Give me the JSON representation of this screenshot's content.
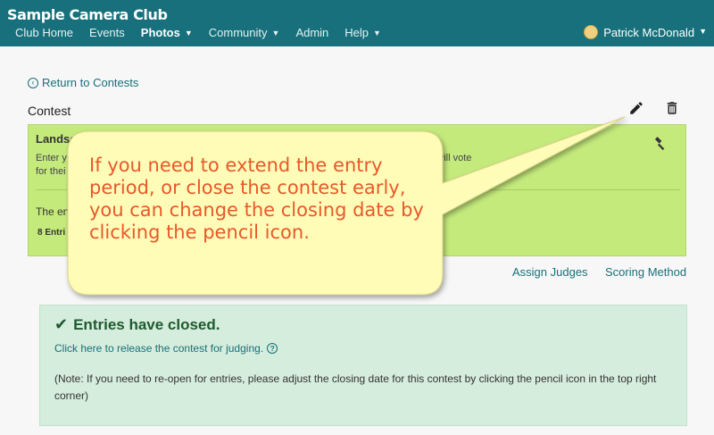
{
  "header": {
    "brand": "Sample Camera Club",
    "nav": [
      {
        "label": "Club Home"
      },
      {
        "label": "Events"
      },
      {
        "label": "Photos"
      },
      {
        "label": "Community"
      },
      {
        "label": "Admin"
      },
      {
        "label": "Help"
      }
    ],
    "user_name": "Patrick McDonald"
  },
  "page": {
    "return_link": "Return to Contests",
    "section_heading": "Contest"
  },
  "contest": {
    "title": "Landsc",
    "description": "Enter y                                                                                                              t club members will vote",
    "description2": "for thei",
    "status": "The en",
    "entries": "8 Entri"
  },
  "links": {
    "assign_judges": "Assign Judges",
    "scoring_method": "Scoring Method"
  },
  "closed": {
    "title": "Entries have closed.",
    "release_link": "Click here to release the contest for judging.",
    "note": "(Note: If you need to re-open for entries, please adjust the closing date for this contest by clicking the pencil icon in the top right corner)"
  },
  "callout": {
    "text": "If you need to extend the entry period, or close the contest early, you can change the closing date by clicking the pencil icon."
  },
  "colors": {
    "header_bg": "#17707b",
    "card_bg": "#c5ea7c",
    "closed_bg": "#d5eddc",
    "callout_bg": "#fffcb8",
    "callout_text": "#e8582a"
  }
}
